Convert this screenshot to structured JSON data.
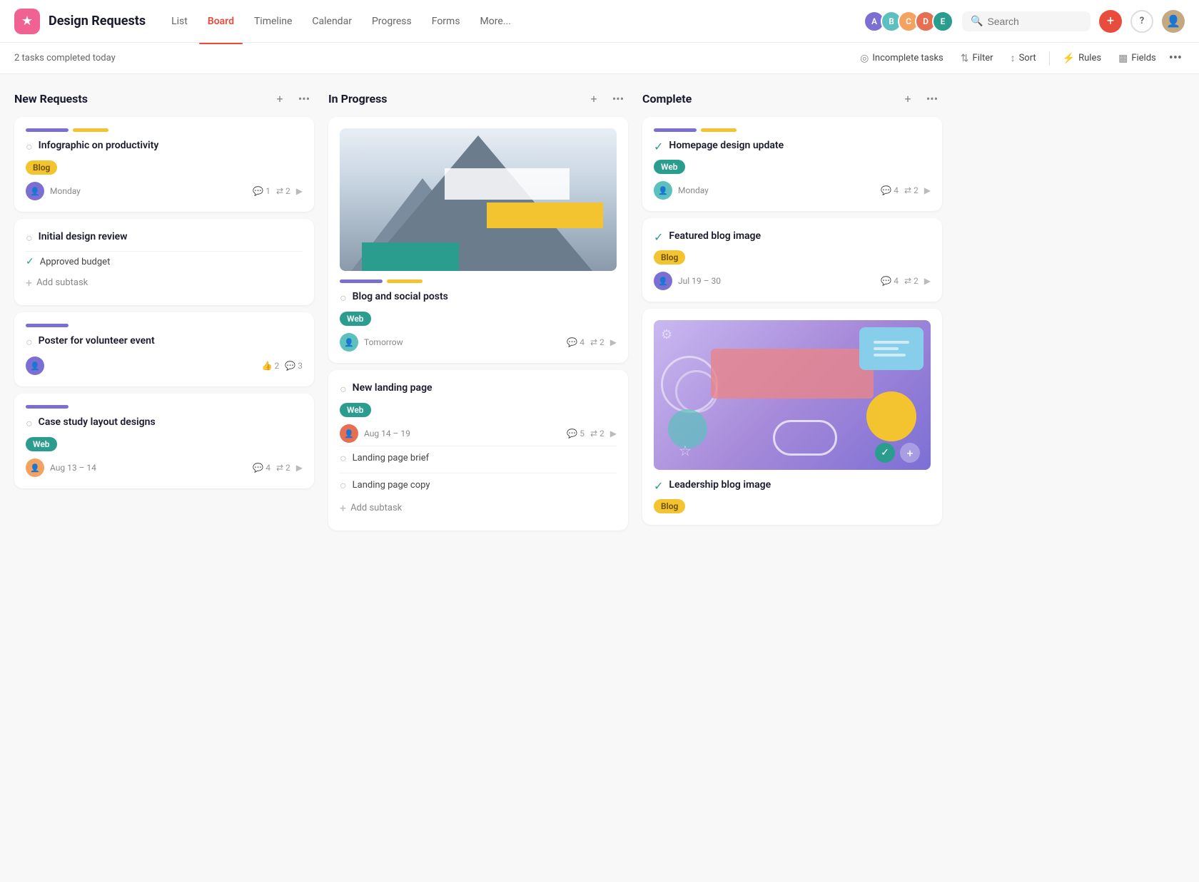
{
  "app": {
    "title": "Design Requests",
    "icon": "★"
  },
  "nav": {
    "tabs": [
      {
        "label": "List",
        "active": false
      },
      {
        "label": "Board",
        "active": true
      },
      {
        "label": "Timeline",
        "active": false
      },
      {
        "label": "Calendar",
        "active": false
      },
      {
        "label": "Progress",
        "active": false
      },
      {
        "label": "Forms",
        "active": false
      },
      {
        "label": "More...",
        "active": false
      }
    ]
  },
  "header": {
    "search_placeholder": "Search"
  },
  "toolbar": {
    "status": "2 tasks completed today",
    "incomplete_tasks": "Incomplete tasks",
    "filter": "Filter",
    "sort": "Sort",
    "rules": "Rules",
    "fields": "Fields"
  },
  "columns": [
    {
      "id": "new-requests",
      "title": "New Requests",
      "cards": [
        {
          "id": "card-1",
          "title": "Infographic on productivity",
          "badge": "Blog",
          "badge_type": "blog",
          "assignee": "ca1",
          "date": "Monday",
          "comments": "1",
          "subtasks": "2",
          "has_expand": true,
          "tags": [
            "purple",
            "yellow"
          ]
        },
        {
          "id": "card-2",
          "title": "Initial design review",
          "subtask_items": [
            {
              "label": "Approved budget",
              "done": true
            }
          ],
          "add_subtask": "Add subtask",
          "tags": []
        },
        {
          "id": "card-3",
          "title": "Poster for volunteer event",
          "assignee": "ca1",
          "date": "",
          "likes": "2",
          "comments": "3",
          "tags": [
            "purple"
          ]
        },
        {
          "id": "card-4",
          "title": "Case study layout designs",
          "badge": "Web",
          "badge_type": "web",
          "assignee": "ca2",
          "date": "Aug 13 – 14",
          "comments": "4",
          "subtasks": "2",
          "has_expand": true,
          "tags": [
            "purple"
          ]
        }
      ]
    },
    {
      "id": "in-progress",
      "title": "In Progress",
      "cards": [
        {
          "id": "card-5",
          "has_image": true,
          "title": "Blog and social posts",
          "badge": "Web",
          "badge_type": "web",
          "assignee": "ca3",
          "date": "Tomorrow",
          "comments": "4",
          "subtasks": "2",
          "has_expand": true,
          "tags": [
            "purple",
            "yellow"
          ]
        },
        {
          "id": "card-6",
          "title": "New landing page",
          "badge": "Web",
          "badge_type": "web",
          "assignee": "ca4",
          "date": "Aug 14 – 19",
          "comments": "5",
          "subtasks": "2",
          "has_expand": true,
          "subtask_items": [
            {
              "label": "Landing page brief",
              "done": false
            },
            {
              "label": "Landing page copy",
              "done": false
            }
          ],
          "add_subtask": "Add subtask",
          "tags": []
        }
      ]
    },
    {
      "id": "complete",
      "title": "Complete",
      "cards": [
        {
          "id": "card-7",
          "title": "Homepage design update",
          "badge": "Web",
          "badge_type": "web",
          "assignee": "ca3",
          "date": "Monday",
          "comments": "4",
          "subtasks": "2",
          "has_expand": true,
          "done": true,
          "tags": [
            "purple",
            "yellow"
          ]
        },
        {
          "id": "card-8",
          "title": "Featured blog image",
          "badge": "Blog",
          "badge_type": "blog",
          "assignee": "ca1",
          "date": "Jul 19 – 30",
          "comments": "4",
          "subtasks": "2",
          "has_expand": true,
          "done": true,
          "tags": []
        },
        {
          "id": "card-9",
          "has_design_preview": true,
          "title": "Leadership blog image",
          "badge": "Blog",
          "badge_type": "blog",
          "done": true,
          "tags": []
        }
      ]
    }
  ],
  "icons": {
    "star": "★",
    "check_circle": "○",
    "check_circle_done": "✓",
    "plus": "+",
    "dots": "•••",
    "search": "🔍",
    "comment": "💬",
    "subtask": "⇄",
    "like": "👍",
    "filter": "⇅",
    "sort": "↕",
    "rules": "⚡",
    "fields": "▦",
    "arrow": "▶"
  }
}
